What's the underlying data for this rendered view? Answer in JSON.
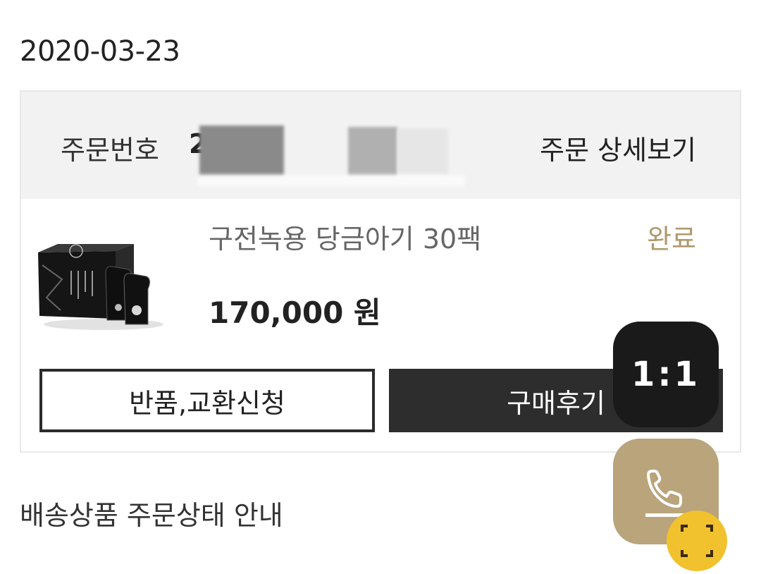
{
  "order": {
    "date": "2020-03-23",
    "number_label": "주문번호",
    "number_value": "2",
    "detail_link": "주문 상세보기"
  },
  "product": {
    "name": "구전녹용 당금아기 30팩",
    "status": "완료",
    "price": "170,000 원",
    "image_icon": "product-box-icon"
  },
  "actions": {
    "return_exchange": "반품,교환신청",
    "review": "구매후기"
  },
  "section": {
    "delivery_title": "배송상품 주문상태 안내"
  },
  "floating": {
    "chat_label": "1:1",
    "call_icon": "phone-icon",
    "scan_icon": "scan-icon"
  },
  "colors": {
    "accent_gold": "#b09a6c",
    "dark_button": "#2d2d2d",
    "header_bg": "#f2f2f2"
  }
}
